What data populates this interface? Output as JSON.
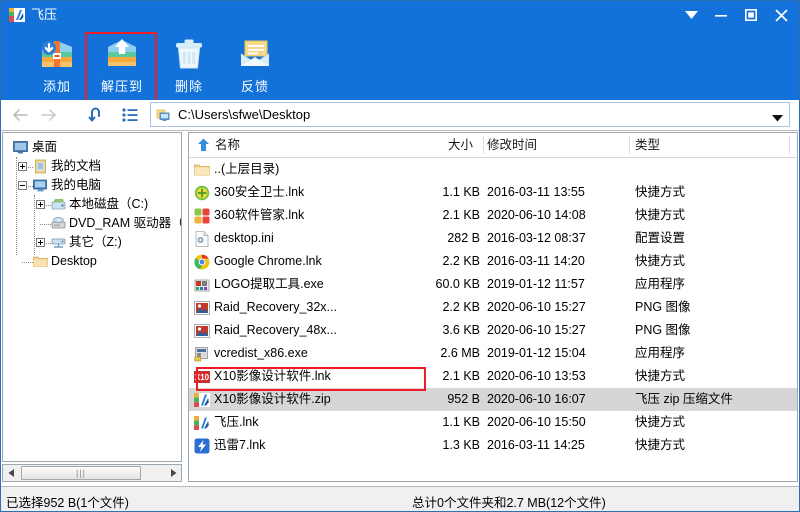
{
  "window": {
    "title": "飞压",
    "app_icon": "app-logo-icon",
    "controls": [
      {
        "name": "menu-dropdown-button",
        "glyph": "dropdown-arrow-icon"
      },
      {
        "name": "minimize-button",
        "glyph": "minimize-icon"
      },
      {
        "name": "maximize-button",
        "glyph": "maximize-icon"
      },
      {
        "name": "close-button",
        "glyph": "close-icon"
      }
    ],
    "titlebar_color": "#1272da"
  },
  "toolbar": {
    "background": "#1272da",
    "buttons": [
      {
        "id": "add",
        "label": "添加",
        "icon": "archive-add-icon"
      },
      {
        "id": "extract",
        "label": "解压到",
        "icon": "archive-extract-icon"
      },
      {
        "id": "delete",
        "label": "删除",
        "icon": "trash-icon"
      },
      {
        "id": "feedback",
        "label": "反馈",
        "icon": "envelope-feedback-icon"
      }
    ],
    "highlight_color": "#ee1c25",
    "highlighted_button": "extract"
  },
  "addressbar": {
    "back": "back-arrow-icon",
    "forward": "forward-arrow-icon",
    "up": "up-level-icon",
    "view": "list-view-icon",
    "path_icon": "computer-icon",
    "path": "C:\\Users\\sfwe\\Desktop",
    "dropdown": "chevron-down-icon"
  },
  "tree": {
    "nodes": [
      {
        "label": "桌面",
        "indent": 0,
        "icon": "desktop-icon",
        "expander": "none"
      },
      {
        "label": "我的文档",
        "indent": 1,
        "icon": "documents-icon",
        "expander": "plus"
      },
      {
        "label": "我的电脑",
        "indent": 1,
        "icon": "computer-icon",
        "expander": "minus"
      },
      {
        "label": "本地磁盘（C:)",
        "indent": 2,
        "icon": "harddisk-icon",
        "expander": "plus"
      },
      {
        "label": "DVD_RAM 驱动器（D",
        "indent": 2,
        "icon": "dvd-drive-icon",
        "expander": "none"
      },
      {
        "label": "其它（Z:)",
        "indent": 2,
        "icon": "network-drive-icon",
        "expander": "plus"
      },
      {
        "label": "Desktop",
        "indent": 2,
        "icon": "folder-icon",
        "expander": "none"
      }
    ],
    "hscroll": {
      "left_arrow": "scroll-left-icon",
      "right_arrow": "scroll-right-icon",
      "grip": "|||"
    }
  },
  "filelist": {
    "columns": [
      {
        "key": "name",
        "label": "名称",
        "sorted": true,
        "sort_dir": "asc"
      },
      {
        "key": "size",
        "label": "大小"
      },
      {
        "key": "date",
        "label": "修改时间"
      },
      {
        "key": "type",
        "label": "类型"
      }
    ],
    "rows": [
      {
        "name": "..(上层目录)",
        "size": "",
        "date": "",
        "type": "",
        "icon": "folder-up-icon",
        "selected": false
      },
      {
        "name": "360安全卫士.lnk",
        "size": "1.1 KB",
        "date": "2016-03-11 13:55",
        "type": "快捷方式",
        "icon": "shield-360-icon",
        "selected": false
      },
      {
        "name": "360软件管家.lnk",
        "size": "2.1 KB",
        "date": "2020-06-10 14:08",
        "type": "快捷方式",
        "icon": "360-software-icon",
        "selected": false
      },
      {
        "name": "desktop.ini",
        "size": "282 B",
        "date": "2016-03-12 08:37",
        "type": "配置设置",
        "icon": "ini-config-icon",
        "selected": false
      },
      {
        "name": "Google Chrome.lnk",
        "size": "2.2 KB",
        "date": "2016-03-11 14:20",
        "type": "快捷方式",
        "icon": "chrome-icon",
        "selected": false
      },
      {
        "name": "LOGO提取工具.exe",
        "size": "60.0 KB",
        "date": "2019-01-12 11:57",
        "type": "应用程序",
        "icon": "exe-logo-tool-icon",
        "selected": false
      },
      {
        "name": "Raid_Recovery_32x...",
        "size": "2.2 KB",
        "date": "2020-06-10 15:27",
        "type": "PNG 图像",
        "icon": "png-image-icon",
        "selected": false
      },
      {
        "name": "Raid_Recovery_48x...",
        "size": "3.6 KB",
        "date": "2020-06-10 15:27",
        "type": "PNG 图像",
        "icon": "png-image-icon",
        "selected": false
      },
      {
        "name": "vcredist_x86.exe",
        "size": "2.6 MB",
        "date": "2019-01-12 15:04",
        "type": "应用程序",
        "icon": "installer-exe-icon",
        "selected": false
      },
      {
        "name": "X10影像设计软件.lnk",
        "size": "2.1 KB",
        "date": "2020-06-10 13:53",
        "type": "快捷方式",
        "icon": "x10-icon",
        "selected": false
      },
      {
        "name": "X10影像设计软件.zip",
        "size": "952 B",
        "date": "2020-06-10 16:07",
        "type": "飞压 zip 压缩文件",
        "icon": "feiya-zip-icon",
        "selected": true
      },
      {
        "name": "飞压.lnk",
        "size": "1.1 KB",
        "date": "2020-06-10 15:50",
        "type": "快捷方式",
        "icon": "feiya-icon",
        "selected": false
      },
      {
        "name": "迅雷7.lnk",
        "size": "1.3 KB",
        "date": "2016-03-11 14:25",
        "type": "快捷方式",
        "icon": "thunder-icon",
        "selected": false
      }
    ],
    "selection_color": "#d6d6d6"
  },
  "statusbar": {
    "left": "已选择952 B(1个文件)",
    "center": "总计0个文件夹和2.7 MB(12个文件)"
  }
}
